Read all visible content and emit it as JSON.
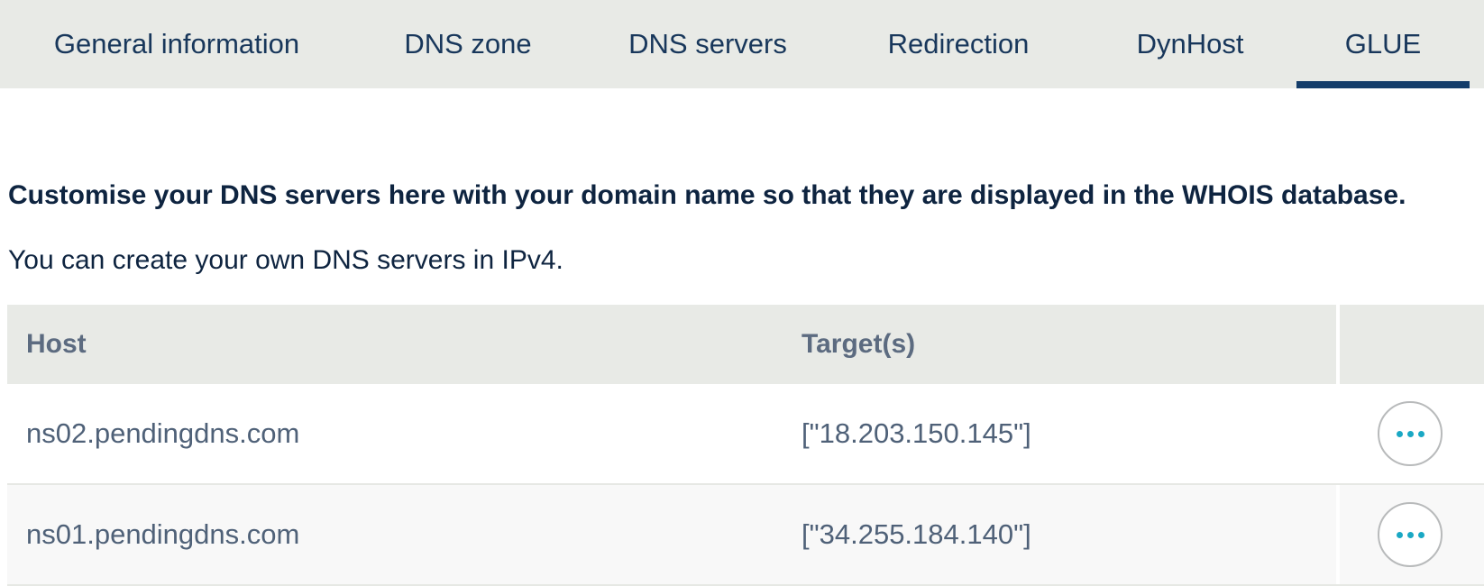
{
  "tabs": [
    {
      "label": "General information",
      "active": false
    },
    {
      "label": "DNS zone",
      "active": false
    },
    {
      "label": "DNS servers",
      "active": false
    },
    {
      "label": "Redirection",
      "active": false
    },
    {
      "label": "DynHost",
      "active": false
    },
    {
      "label": "GLUE",
      "active": true
    }
  ],
  "intro": {
    "heading": "Customise your DNS servers here with your domain name so that they are displayed in the WHOIS database.",
    "text": "You can create your own DNS servers in IPv4."
  },
  "table": {
    "columns": [
      "Host",
      "Target(s)",
      ""
    ],
    "rows": [
      {
        "host": "ns02.pendingdns.com",
        "targets": "[\"18.203.150.145\"]",
        "action_icon": "more-horizontal-icon"
      },
      {
        "host": "ns01.pendingdns.com",
        "targets": "[\"34.255.184.140\"]",
        "action_icon": "more-horizontal-icon"
      }
    ]
  },
  "colors": {
    "tab_text": "#18375b",
    "active_indicator": "#143d6a",
    "header_bg": "#e8eae6",
    "action_dots": "#1aa8c4"
  }
}
